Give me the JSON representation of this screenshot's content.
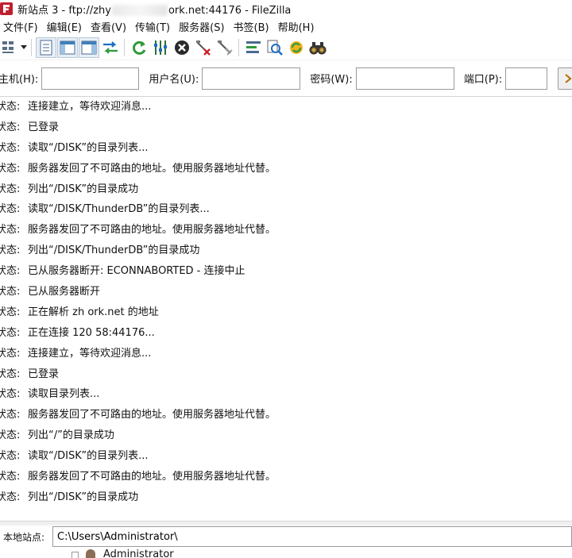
{
  "window": {
    "title_prefix": "新站点 3 - ftp://zhy",
    "title_suffix": "ork.net:44176 - FileZilla"
  },
  "menu": [
    "文件(F)",
    "编辑(E)",
    "查看(V)",
    "传输(T)",
    "服务器(S)",
    "书签(B)",
    "帮助(H)"
  ],
  "toolbar": {
    "icons": [
      "site-manager-icon",
      "dropdown-arrow-icon",
      "toggle-message-log-icon",
      "toggle-local-tree-icon",
      "toggle-remote-tree-icon",
      "toggle-transfer-queue-icon",
      "refresh-icon",
      "process-queue-icon",
      "cancel-icon",
      "disconnect-icon",
      "reconnect-icon",
      "directory-filter-icon",
      "compare-icon",
      "sync-browse-icon",
      "search-icon"
    ]
  },
  "quickconnect": {
    "host_label": "主机(H):",
    "host_value": "",
    "user_label": "用户名(U):",
    "user_value": "",
    "password_label": "密码(W):",
    "password_value": "",
    "port_label": "端口(P):",
    "port_value": ""
  },
  "log": [
    {
      "status": "状态:",
      "message": "连接建立，等待欢迎消息..."
    },
    {
      "status": "状态:",
      "message": "已登录"
    },
    {
      "status": "状态:",
      "message": "读取“/DISK”的目录列表..."
    },
    {
      "status": "状态:",
      "message": "服务器发回了不可路由的地址。使用服务器地址代替。"
    },
    {
      "status": "状态:",
      "message": "列出“/DISK”的目录成功"
    },
    {
      "status": "状态:",
      "message": "读取“/DISK/ThunderDB”的目录列表..."
    },
    {
      "status": "状态:",
      "message": "服务器发回了不可路由的地址。使用服务器地址代替。"
    },
    {
      "status": "状态:",
      "message": "列出“/DISK/ThunderDB”的目录成功"
    },
    {
      "status": "状态:",
      "message": "已从服务器断开: ECONNABORTED - 连接中止"
    },
    {
      "status": "状态:",
      "message": "已从服务器断开"
    },
    {
      "status": "状态:",
      "message": "正在解析 zh      ork.net 的地址"
    },
    {
      "status": "状态:",
      "message": "正在连接 120      58:44176..."
    },
    {
      "status": "状态:",
      "message": "连接建立，等待欢迎消息..."
    },
    {
      "status": "状态:",
      "message": "已登录"
    },
    {
      "status": "状态:",
      "message": "读取目录列表..."
    },
    {
      "status": "状态:",
      "message": "服务器发回了不可路由的地址。使用服务器地址代替。"
    },
    {
      "status": "状态:",
      "message": "列出“/”的目录成功"
    },
    {
      "status": "状态:",
      "message": "读取“/DISK”的目录列表..."
    },
    {
      "status": "状态:",
      "message": "服务器发回了不可路由的地址。使用服务器地址代替。"
    },
    {
      "status": "状态:",
      "message": "列出“/DISK”的目录成功"
    }
  ],
  "local_site": {
    "label": "本地站点:",
    "path": "C:\\Users\\Administrator\\"
  },
  "tree": {
    "item_label": "Administrator"
  },
  "colors": {
    "accent_blue": "#1c6fc4",
    "green": "#2e9a3c",
    "red": "#c8222c"
  }
}
